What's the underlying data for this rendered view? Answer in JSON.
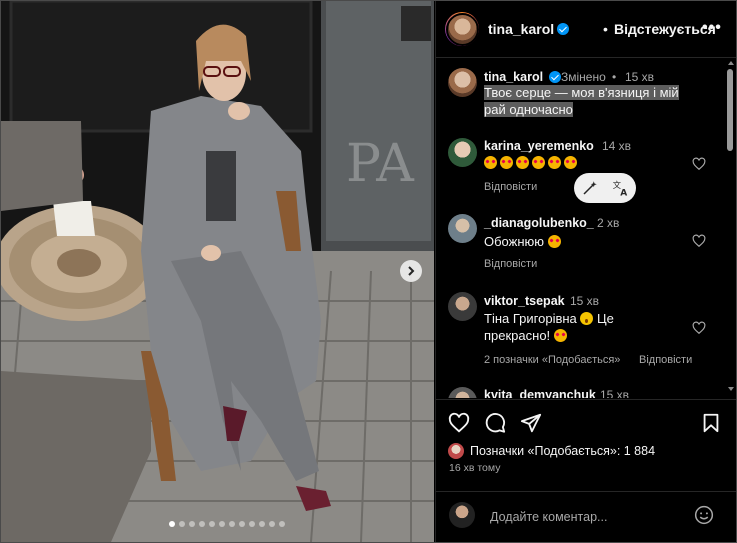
{
  "header": {
    "username": "tina_karol",
    "separator": "•",
    "follow_label": "Відстежується",
    "more_label": "•••"
  },
  "comments": [
    {
      "username": "tina_karol",
      "edited": "Змінено",
      "time": "15 хв",
      "text_line1": "Твоє серце — моя в'язниця і мій",
      "text_line2": "рай одночасно"
    },
    {
      "username": "karina_yeremenko",
      "time": "14 хв",
      "reply": "Відповісти"
    },
    {
      "username": "_dianagolubenko_",
      "time": "2 хв",
      "text": "Обожнюю",
      "reply": "Відповісти"
    },
    {
      "username": "viktor_tsepak",
      "time": "15 хв",
      "text_line1": "Тіна Григорівна",
      "text_line1b": "Це",
      "text_line2": "прекрасно!",
      "likes": "2 позначки «Подобається»",
      "reply": "Відповісти"
    },
    {
      "username": "kvita_demyanchuk",
      "time": "15 хв"
    }
  ],
  "actions": {
    "likes_text": "Позначки «Подобається»: 1 884",
    "time_ago": "16 хв тому"
  },
  "comment_box": {
    "placeholder": "Додайте коментар..."
  },
  "carousel": {
    "dot_count": 12,
    "active_index": 0
  },
  "colors": {
    "verified": "#0095f6",
    "text_secondary": "#a8a8a8",
    "highlight": "#5d5d5d"
  }
}
